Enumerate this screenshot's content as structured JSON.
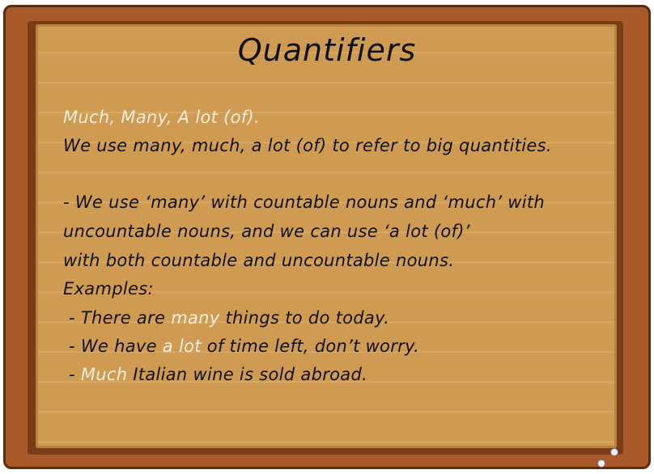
{
  "title": "Quantifiers",
  "heading": "Much, Many, A lot (of).",
  "lines": [
    [
      {
        "t": "We use many, much, a lot (of) to refer to big quantities.",
        "h": false
      }
    ],
    [
      {
        "t": "- We use ‘many’ with countable nouns and ‘much’ with",
        "h": false
      }
    ],
    [
      {
        "t": "uncountable nouns, and we can use ‘a lot (of)’",
        "h": false
      }
    ],
    [
      {
        "t": "with both countable and uncountable nouns.",
        "h": false
      }
    ],
    [
      {
        "t": "Examples:",
        "h": false
      }
    ],
    [
      {
        "t": " - There are ",
        "h": false
      },
      {
        "t": "many",
        "h": true
      },
      {
        "t": " things to do today.",
        "h": false
      }
    ],
    [
      {
        "t": " - We have ",
        "h": false
      },
      {
        "t": "a lot",
        "h": true
      },
      {
        "t": " of time left, don’t worry.",
        "h": false
      }
    ],
    [
      {
        "t": " - ",
        "h": false
      },
      {
        "t": "Much",
        "h": true
      },
      {
        "t": " Italian wine is sold abroad.",
        "h": false
      }
    ]
  ],
  "colors": {
    "highlight": "#f5eedd",
    "text": "#111111",
    "wood": "#cf9a52",
    "frame": "#a85a2a"
  }
}
